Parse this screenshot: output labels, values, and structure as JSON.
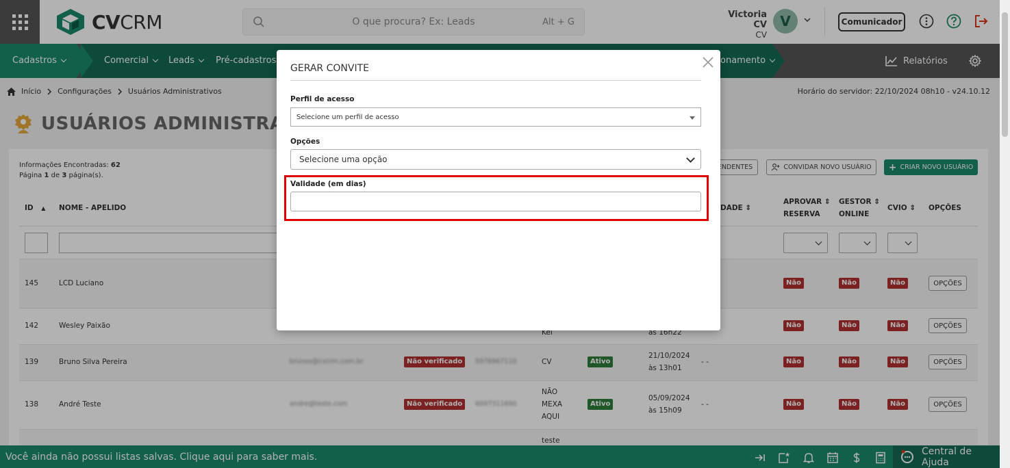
{
  "header": {
    "brand_strong": "CV",
    "brand_light": "CRM",
    "search_placeholder": "O que procura? Ex: Leads",
    "search_shortcut": "Alt + G",
    "user_name": "Victoria CV",
    "user_sub": "CV",
    "avatar_letter": "V",
    "comunicador_label": "Comunicador"
  },
  "nav": {
    "items": [
      "Cadastros",
      "Comercial",
      "Leads",
      "Pré-cadastros",
      "onamento"
    ],
    "relatorios": "Relatórios"
  },
  "breadcrumb": [
    "Início",
    "Configurações",
    "Usuários Administrativos"
  ],
  "server_time": "Horário do servidor: 22/10/2024 08h10 - v24.10.12",
  "page_title": "USUÁRIOS ADMINISTRATI",
  "info": {
    "found_label": "Informações Encontradas:",
    "found_count": "62",
    "page_prefix": "Página",
    "page_current": "1",
    "page_mid": "de",
    "page_total": "3",
    "page_suffix": "página(s)."
  },
  "toolbar": {
    "pendentes": "ENDENTES",
    "convidar": "CONVIDAR NOVO USUÁRIO",
    "criar": "CRIAR NOVO USUÁRIO"
  },
  "table": {
    "headers": {
      "id": "ID",
      "nome": "NOME - APELIDO",
      "dade": "DADE",
      "aprovar1": "APROVAR",
      "aprovar2": "RESERVA",
      "gestor1": "GESTOR",
      "gestor2": "ONLINE",
      "cvio": "CVIO",
      "opcoes": "OPÇÕES"
    },
    "rows": [
      {
        "id": "145",
        "nome": "LCD Luciano",
        "aprovar": "Não",
        "gestor": "Não",
        "cvio": "Não",
        "opcoes": "OPÇÕES"
      },
      {
        "id": "142",
        "nome": "Wesley Paixão",
        "perfil": "Kei",
        "data2": "às 16h22",
        "aprovar": "Não",
        "gestor": "Não",
        "cvio": "Não",
        "opcoes": "OPÇÕES"
      },
      {
        "id": "139",
        "nome": "Bruno Silva Pereira",
        "email": "brunos@cvcrm.com.br",
        "status": "Não verificado",
        "phone": "5976967110",
        "perfil": "CV",
        "situacao": "Ativo",
        "data1": "21/10/2024",
        "data2": "às 13h01",
        "dash": "- -",
        "aprovar": "Não",
        "gestor": "Não",
        "cvio": "Não",
        "opcoes": "OPÇÕES"
      },
      {
        "id": "138",
        "nome": "André Teste",
        "email": "andre@teste.com",
        "status": "Não verificado",
        "phone": "6097311690",
        "perfil1": "NÃO",
        "perfil2": "MEXA",
        "perfil3": "AQUI",
        "situacao": "Ativo",
        "data1": "05/09/2024",
        "data2": "às 15h09",
        "dash": "- -",
        "aprovar": "Não",
        "gestor": "Não",
        "cvio": "Não",
        "opcoes": "OPÇÕES"
      },
      {
        "perfil": "teste"
      }
    ]
  },
  "footer": {
    "text": "Você ainda não possui listas salvas. Clique aqui para saber mais.",
    "help": "Central de Ajuda"
  },
  "modal": {
    "title": "GERAR CONVITE",
    "perfil_label": "Perfil de acesso",
    "perfil_placeholder": "Selecione um perfil de acesso",
    "opcoes_label": "Opções",
    "opcoes_placeholder": "Selecione uma opção",
    "validade_label": "Validade (em dias)",
    "validade_value": ""
  },
  "colors": {
    "brand_green": "#1a8a6a",
    "brand_dark_green": "#136b52",
    "danger": "#b03030",
    "success": "#2e7d3a",
    "highlight": "#e00000"
  }
}
